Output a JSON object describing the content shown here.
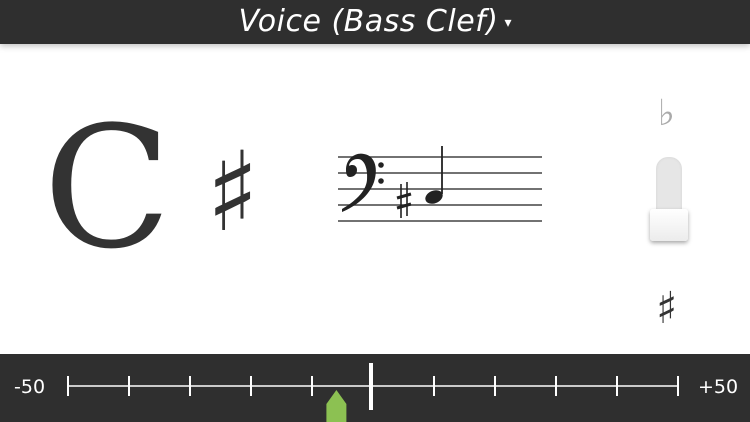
{
  "header": {
    "title": "Voice (Bass Clef)",
    "caret": "▾"
  },
  "note": {
    "letter": "C",
    "accidental": "♯"
  },
  "staff": {
    "clef": "bass",
    "accidental": "♯"
  },
  "tuning_slider": {
    "flat_symbol": "♭",
    "sharp_symbol": "♯",
    "level": 0.85
  },
  "meter": {
    "min_label": "-50",
    "max_label": "+50",
    "min": -50,
    "max": 50,
    "needle_cents": -6,
    "center": 0
  },
  "colors": {
    "bar": "#2f2f2f",
    "indicator": "#8cc152",
    "text": "#333333"
  }
}
